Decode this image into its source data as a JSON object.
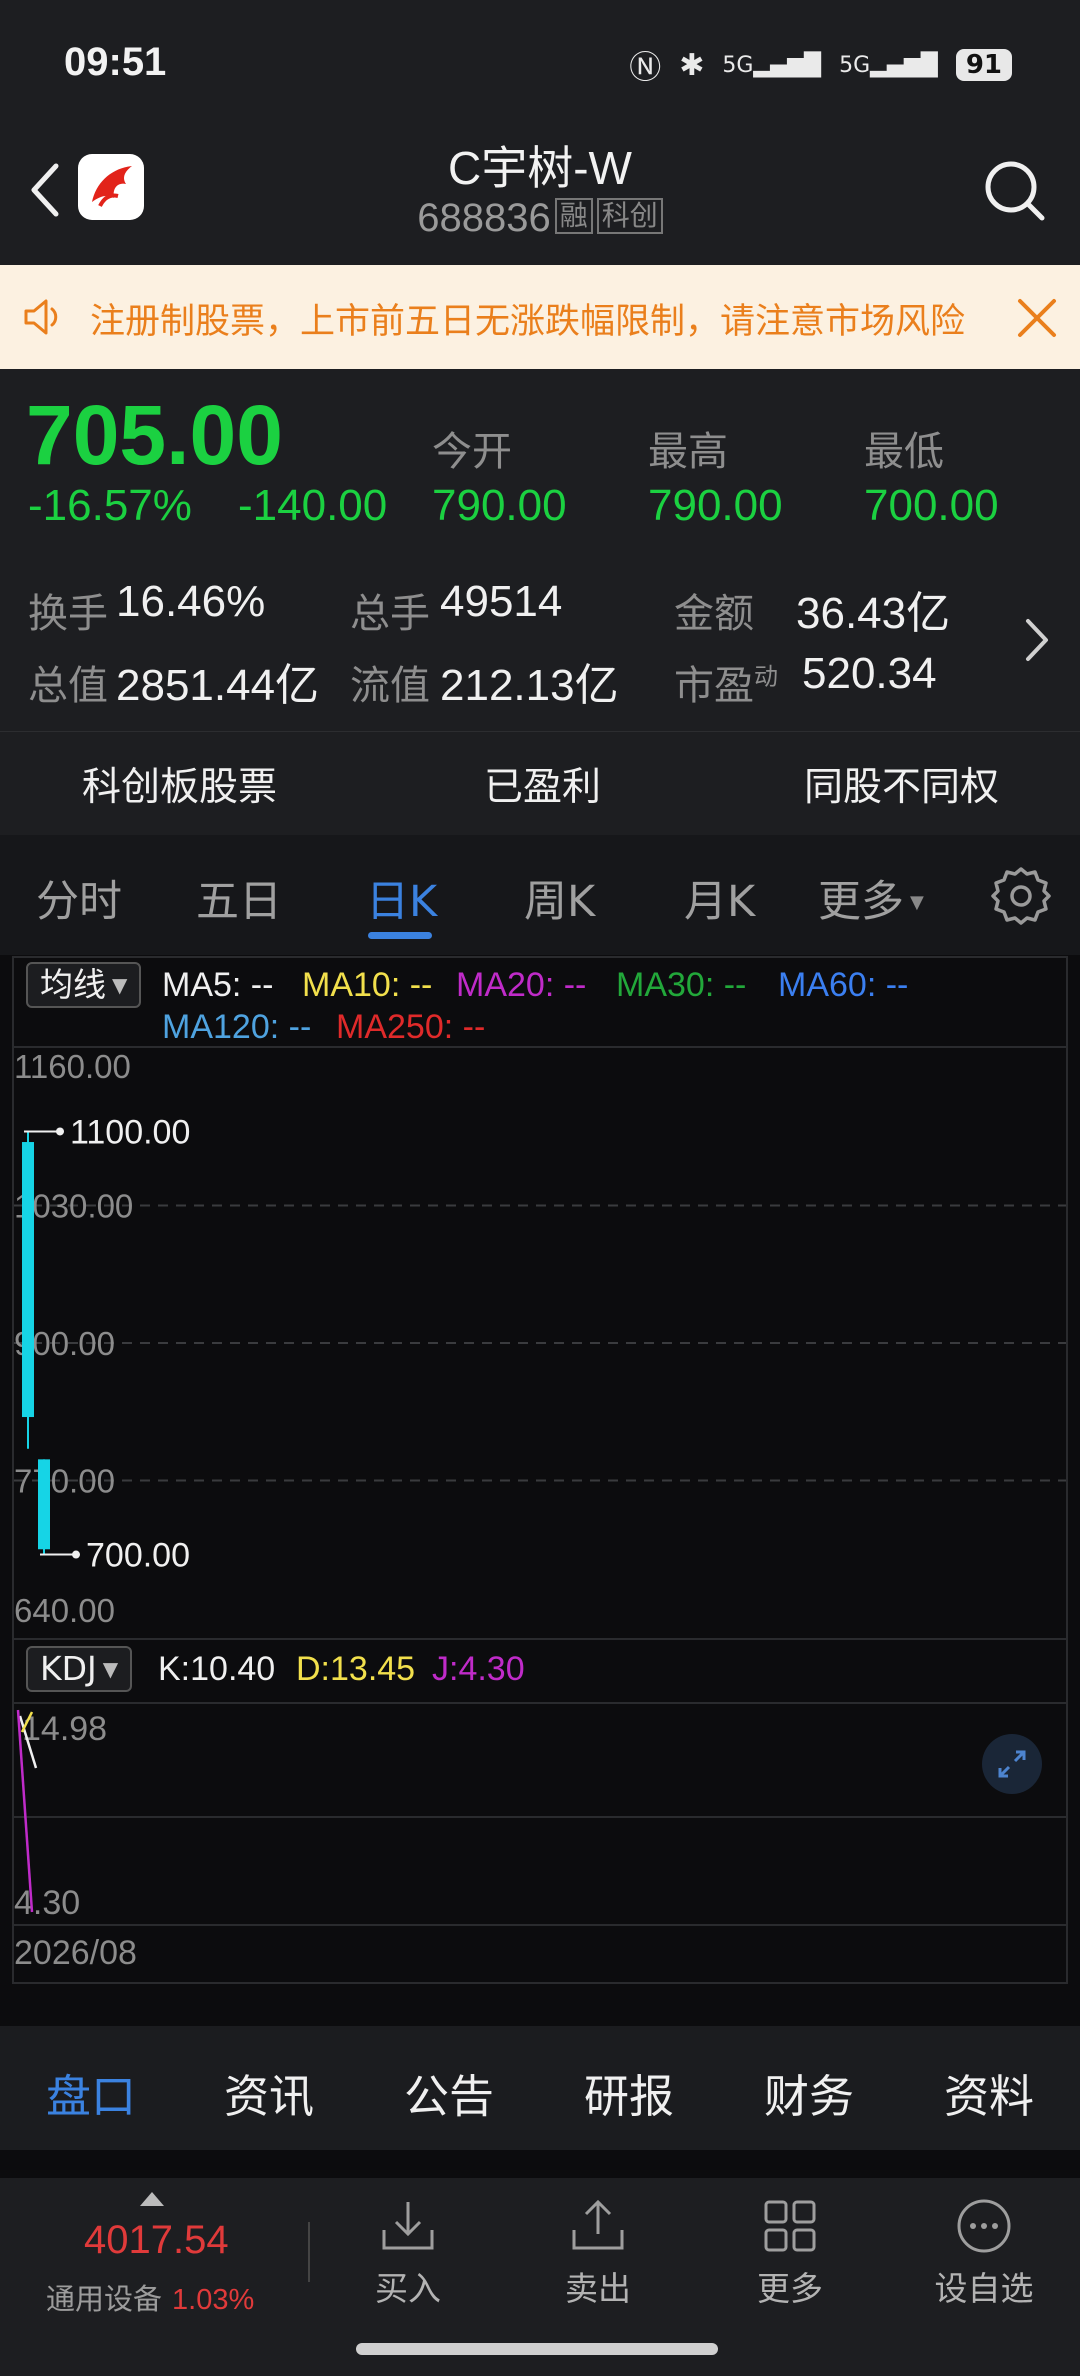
{
  "status_bar": {
    "time": "09:51",
    "battery": "91",
    "signal1": "5G",
    "signal2": "5G"
  },
  "header": {
    "title": "C宇树-W",
    "code": "688836",
    "tag_margin": "融",
    "tag_board": "科创"
  },
  "banner": {
    "text": "注册制股票，上市前五日无涨跌幅限制，请注意市场风险"
  },
  "quote": {
    "price": "705.00",
    "change_pct": "-16.57%",
    "change_amt": "-140.00",
    "open_label": "今开",
    "open": "790.00",
    "high_label": "最高",
    "high": "790.00",
    "low_label": "最低",
    "low": "700.00",
    "turnover_label": "换手",
    "turnover": "16.46%",
    "volume_label": "总手",
    "volume": "49514",
    "amount_label": "金额",
    "amount": "36.43亿",
    "mktcap_label": "总值",
    "mktcap": "2851.44亿",
    "float_label": "流值",
    "float": "212.13亿",
    "pe_label": "市盈",
    "pe_sup": "动",
    "pe": "520.34"
  },
  "tags": [
    "科创板股票",
    "已盈利",
    "同股不同权"
  ],
  "period_tabs": [
    "分时",
    "五日",
    "日K",
    "周K",
    "月K",
    "更多"
  ],
  "active_period": "日K",
  "indicators": {
    "ma_button": "均线",
    "ma": [
      {
        "text": "MA5: --",
        "color": "#f0f0f0"
      },
      {
        "text": "MA10: --",
        "color": "#f2e04c"
      },
      {
        "text": "MA20: --",
        "color": "#c02bc9"
      },
      {
        "text": "MA30: --",
        "color": "#22a83a"
      },
      {
        "text": "MA60: --",
        "color": "#3b7ff0"
      },
      {
        "text": "MA120: --",
        "color": "#4fa3e0"
      },
      {
        "text": "MA250: --",
        "color": "#e02a2a"
      }
    ],
    "kdj_button": "KDJ",
    "kdj": [
      {
        "text": "K:10.40",
        "color": "#f0f0f0"
      },
      {
        "text": "D:13.45",
        "color": "#f2e04c"
      },
      {
        "text": "J:4.30",
        "color": "#c02bc9"
      }
    ]
  },
  "chart_data": {
    "type": "candlestick",
    "y_ticks": [
      "1160.00",
      "1030.00",
      "900.00",
      "770.00",
      "640.00"
    ],
    "ylim": [
      640,
      1160
    ],
    "annotations": [
      {
        "text": "1100.00",
        "value": 1100
      },
      {
        "text": "700.00",
        "value": 700
      }
    ],
    "candles": [
      {
        "open": 1090,
        "close": 830,
        "high": 1100,
        "low": 800,
        "color": "#16d4e6"
      },
      {
        "open": 790,
        "close": 705,
        "high": 790,
        "low": 700,
        "color": "#16d4e6"
      }
    ],
    "kdj_ticks": [
      "14.98",
      "4.30"
    ],
    "x_label": "2026/08"
  },
  "bottom_tabs": [
    "盘口",
    "资讯",
    "公告",
    "研报",
    "财务",
    "资料"
  ],
  "active_bottom_tab": "盘口",
  "footer": {
    "index_value": "4017.54",
    "index_name": "通用设备",
    "index_change": "1.03%",
    "buy": "买入",
    "sell": "卖出",
    "more": "更多",
    "watch": "设自选"
  }
}
